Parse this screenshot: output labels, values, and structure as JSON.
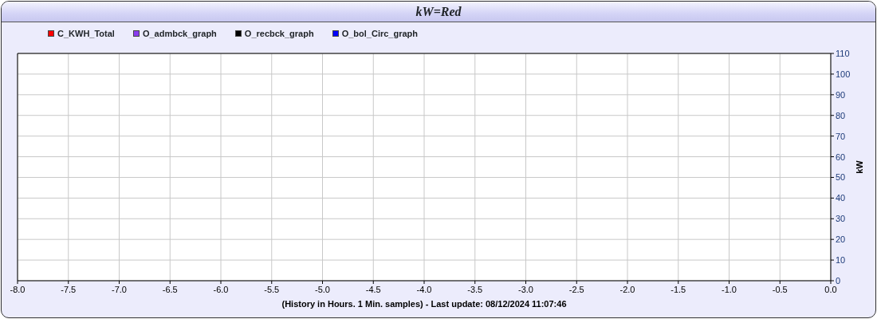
{
  "chart_data": {
    "type": "line",
    "grid": true,
    "title": "kW=Red",
    "xlabel": "(History in Hours. 1 Min. samples) - Last update: 08/12/2024 11:07:46",
    "ylabel": "kW",
    "series": [
      {
        "name": "C_KWH_Total",
        "color": "#ff0000",
        "values": [
          null,
          null,
          null,
          null,
          null,
          null,
          null,
          null,
          null,
          null,
          null,
          null,
          null,
          null,
          null,
          null,
          null
        ]
      },
      {
        "name": "O_admbck_graph",
        "color": "#8a3cf0",
        "values": [
          null,
          null,
          null,
          null,
          null,
          null,
          null,
          null,
          null,
          null,
          null,
          null,
          null,
          null,
          null,
          null,
          null
        ]
      },
      {
        "name": "O_recbck_graph",
        "color": "#000000",
        "values": [
          null,
          null,
          null,
          null,
          null,
          null,
          null,
          null,
          null,
          null,
          null,
          null,
          null,
          null,
          null,
          null,
          null
        ]
      },
      {
        "name": "O_bol_Circ_graph",
        "color": "#0000ff",
        "values": [
          null,
          null,
          null,
          null,
          null,
          null,
          null,
          null,
          null,
          null,
          null,
          null,
          null,
          null,
          null,
          null,
          null
        ]
      }
    ],
    "categories": [
      "-8.0",
      "-7.5",
      "-7.0",
      "-6.5",
      "-6.0",
      "-5.5",
      "-5.0",
      "-4.5",
      "-4.0",
      "-3.5",
      "-3.0",
      "-2.5",
      "-2.0",
      "-1.5",
      "-1.0",
      "-0.5",
      "0.0"
    ],
    "ylim": [
      0,
      110
    ],
    "yticks": [
      0,
      10,
      20,
      30,
      40,
      50,
      60,
      70,
      80,
      90,
      100,
      110
    ]
  }
}
